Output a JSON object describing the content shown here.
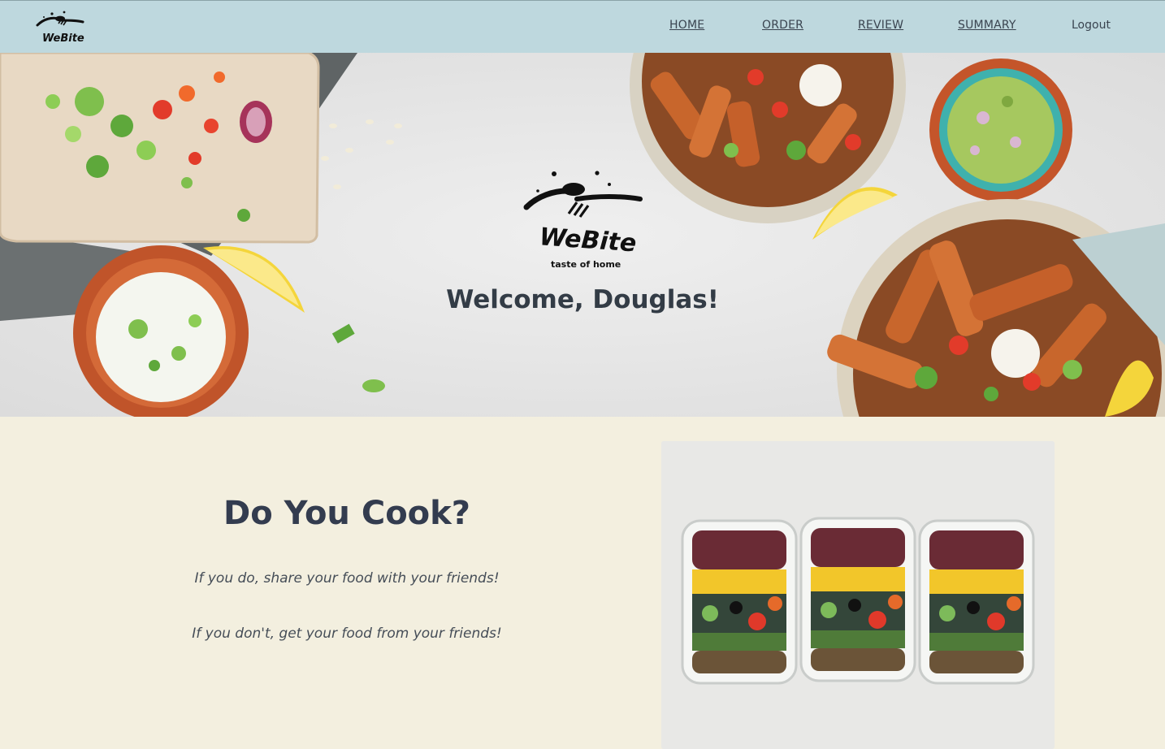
{
  "navbar": {
    "logo_icon": "webite-logo-icon",
    "links": [
      {
        "label": "HOME"
      },
      {
        "label": "ORDER"
      },
      {
        "label": "REVIEW"
      },
      {
        "label": "SUMMARY"
      }
    ],
    "logout_label": "Logout",
    "background": "#bed8de"
  },
  "hero": {
    "logo": {
      "brand": "WeBite",
      "tagline": "taste of home"
    },
    "welcome": "Welcome, Douglas!"
  },
  "section": {
    "title": "Do You Cook?",
    "line1": "If you do, share your food with your friends!",
    "line2": "If you don't, get your food from your friends!",
    "background": "#f3efdf",
    "photo_icon": "meal-prep-containers-image"
  }
}
